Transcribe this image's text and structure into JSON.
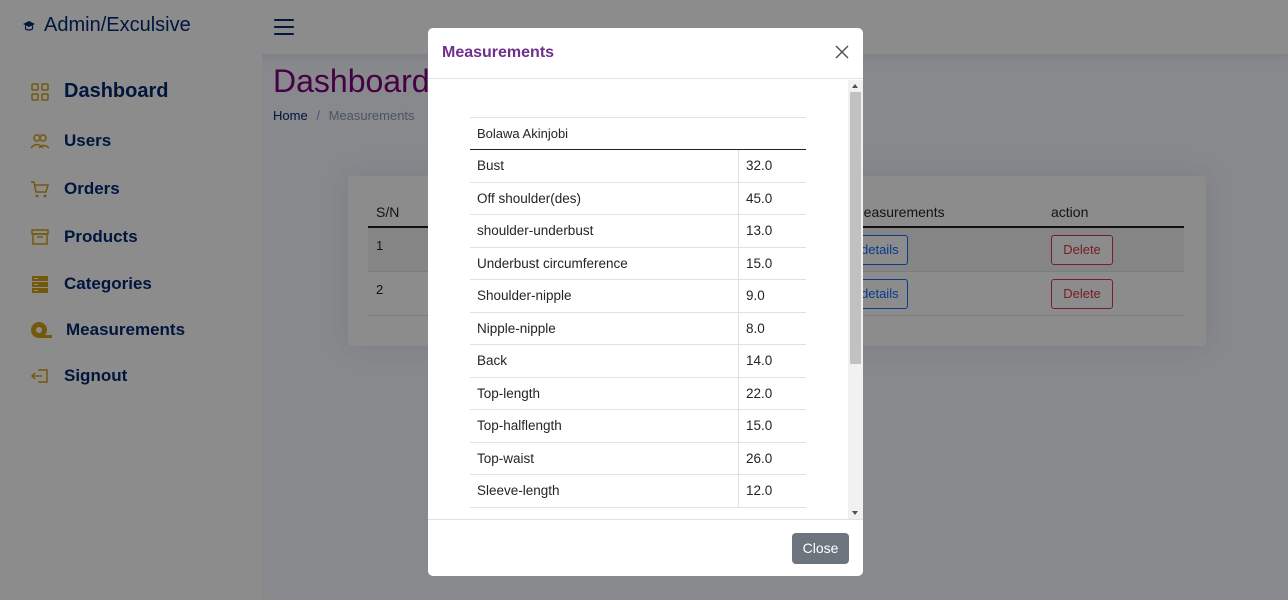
{
  "header": {
    "brand": "Admin/Exculsive"
  },
  "sidebar": {
    "items": [
      {
        "label": "Dashboard",
        "icon": "grid-icon"
      },
      {
        "label": "Users",
        "icon": "users-icon"
      },
      {
        "label": "Orders",
        "icon": "cart-icon"
      },
      {
        "label": "Products",
        "icon": "box-icon"
      },
      {
        "label": "Categories",
        "icon": "layers-icon"
      },
      {
        "label": "Measurements",
        "icon": "tape-measure-icon"
      },
      {
        "label": "Signout",
        "icon": "signout-icon"
      }
    ]
  },
  "main": {
    "title": "Dashboard",
    "breadcrumb": {
      "home": "Home",
      "sep": "/",
      "current": "Measurements"
    },
    "table": {
      "headers": [
        "S/N",
        "measurements",
        "action"
      ],
      "rows": [
        {
          "sn": "1",
          "details": "details",
          "delete": "Delete"
        },
        {
          "sn": "2",
          "details": "details",
          "delete": "Delete"
        }
      ]
    }
  },
  "modal": {
    "title": "Measurements",
    "customer": "Bolawa Akinjobi",
    "rows": [
      {
        "k": "Bust",
        "v": "32.0"
      },
      {
        "k": "Off shoulder(des)",
        "v": "45.0"
      },
      {
        "k": "shoulder-underbust",
        "v": "13.0"
      },
      {
        "k": "Underbust circumference",
        "v": "15.0"
      },
      {
        "k": "Shoulder-nipple",
        "v": "9.0"
      },
      {
        "k": "Nipple-nipple",
        "v": "8.0"
      },
      {
        "k": "Back",
        "v": "14.0"
      },
      {
        "k": "Top-length",
        "v": "22.0"
      },
      {
        "k": "Top-halflength",
        "v": "15.0"
      },
      {
        "k": "Top-waist",
        "v": "26.0"
      },
      {
        "k": "Sleeve-length",
        "v": "12.0"
      }
    ],
    "close_label": "Close"
  },
  "colors": {
    "brand": "#012970",
    "title": "#800080",
    "modal_title": "#6f2f8a",
    "sidebar_icon": "#d4a017"
  }
}
